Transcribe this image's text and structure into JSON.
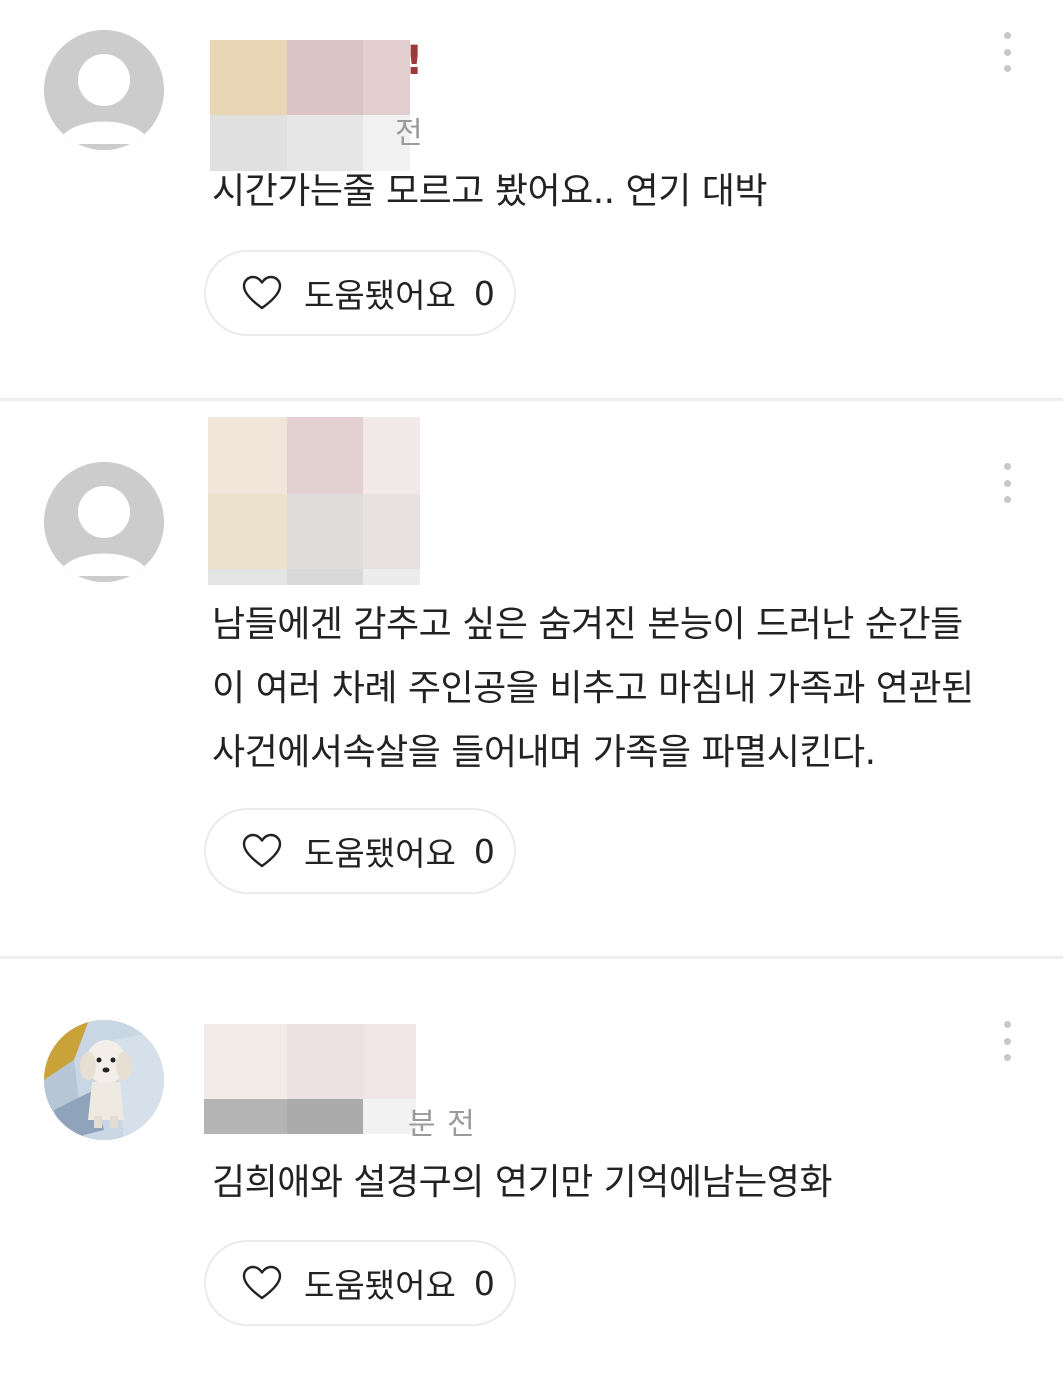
{
  "reviews": [
    {
      "author": "",
      "time_suffix": "전",
      "text": "시간가는줄 모르고 봤어요.. 연기 대박",
      "helpful_label": "도움됐어요",
      "helpful_count": "0",
      "avatar_icon": "default-user-icon"
    },
    {
      "author": "",
      "time_suffix": "",
      "text": "남들에겐 감추고 싶은 숨겨진 본능이 드러난 순간들\n이 여러 차례 주인공을 비추고 마침내 가족과 연관된\n사건에서속살을 들어내며 가족을 파멸시킨다.",
      "helpful_label": "도움됐어요",
      "helpful_count": "0",
      "avatar_icon": "default-user-icon"
    },
    {
      "author": "",
      "time_suffix": "분 전",
      "text": "김희애와 설경구의 연기만 기억에남는영화",
      "helpful_label": "도움됐어요",
      "helpful_count": "0",
      "avatar_icon": "dog-photo-avatar"
    }
  ],
  "icons": {
    "more": "more-vertical-icon",
    "heart": "heart-outline-icon"
  },
  "colors": {
    "divider": "#eeeeee",
    "avatar_bg": "#cccccc",
    "text": "#222222",
    "muted": "#9a9a9a"
  }
}
